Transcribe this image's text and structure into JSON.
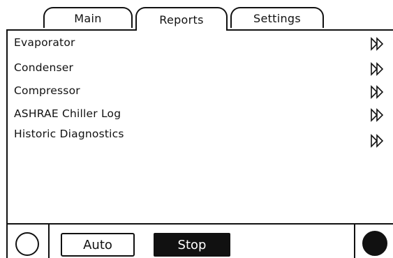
{
  "tabs": [
    {
      "label": "Main"
    },
    {
      "label": "Reports"
    },
    {
      "label": "Settings"
    }
  ],
  "active_tab": "Reports",
  "reports": [
    {
      "label": "Evaporator"
    },
    {
      "label": "Condenser"
    },
    {
      "label": "Compressor"
    },
    {
      "label": "ASHRAE Chiller Log"
    },
    {
      "label": "Historic Diagnostics"
    }
  ],
  "controls": {
    "auto_label": "Auto",
    "stop_label": "Stop"
  }
}
